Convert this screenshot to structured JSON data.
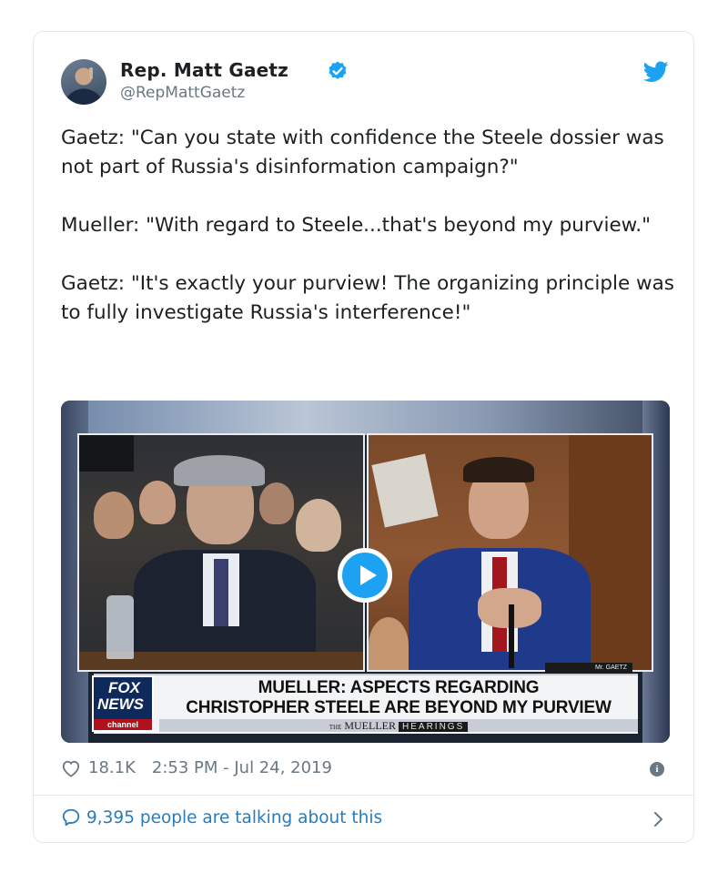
{
  "author": {
    "name": "Rep. Matt Gaetz",
    "handle": "@RepMattGaetz",
    "verified": true
  },
  "tweet": {
    "text": "Gaetz: \"Can you state with confidence the Steele dossier was not part of Russia's disinformation campaign?\"\n\nMueller: \"With regard to Steele...that's beyond my purview.\"\n\nGaetz: \"It's exactly your purview! The organizing principle was to fully investigate Russia's interference!\""
  },
  "media": {
    "type": "video",
    "network_logo": {
      "line1": "FOX",
      "line2": "NEWS",
      "line3": "channel"
    },
    "chyron_line1": "MUELLER: ASPECTS REGARDING",
    "chyron_line2": "CHRISTOPHER STEELE ARE BEYOND MY PURVIEW",
    "hearing_prefix": "THE",
    "hearing_main": "MUELLER",
    "hearing_sub": "HEARINGS",
    "nameplate": "Mr. GAETZ"
  },
  "meta": {
    "likes": "18.1K",
    "timestamp": "2:53 PM - Jul 24, 2019"
  },
  "footer": {
    "talking": "9,395 people are talking about this"
  },
  "colors": {
    "accent": "#1da1f2",
    "link": "#2b7bb9",
    "muted": "#697882",
    "text": "#1c2022"
  },
  "icons": [
    "verified-icon",
    "twitter-bird-icon",
    "play-icon",
    "heart-icon",
    "info-icon",
    "speech-bubble-icon",
    "chevron-right-icon"
  ]
}
